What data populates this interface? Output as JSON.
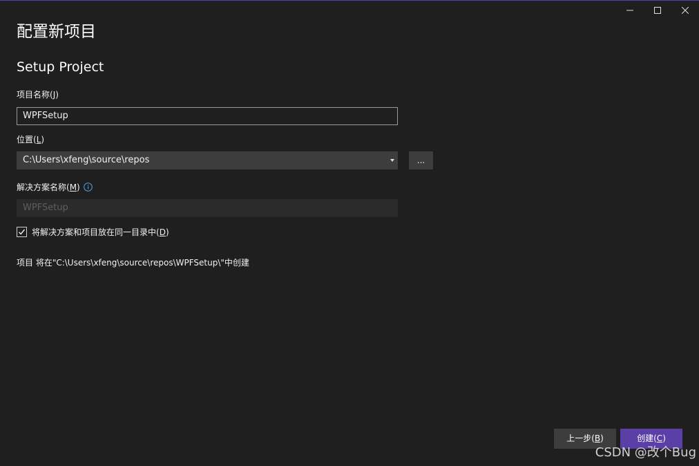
{
  "window": {
    "minimize_icon": "minimize-icon",
    "maximize_icon": "maximize-icon",
    "close_icon": "close-icon"
  },
  "header": {
    "title": "配置新项目",
    "template_name": "Setup Project"
  },
  "project_name": {
    "label": "项目名称(",
    "accel": "J",
    "label_end": ")",
    "value": "WPFSetup"
  },
  "location": {
    "label": "位置(",
    "accel": "L",
    "label_end": ")",
    "value": "C:\\Users\\xfeng\\source\\repos",
    "browse_label": "..."
  },
  "solution_name": {
    "label": "解决方案名称(",
    "accel": "M",
    "label_end": ")",
    "value": "WPFSetup",
    "info_icon": "info-icon"
  },
  "same_directory": {
    "checked": true,
    "label": "将解决方案和项目放在同一目录中(",
    "accel": "D",
    "label_end": ")"
  },
  "info_text": "项目 将在\"C:\\Users\\xfeng\\source\\repos\\WPFSetup\\\"中创建",
  "footer": {
    "back_label": "上一步(",
    "back_accel": "B",
    "back_end": ")",
    "create_label": "创建(",
    "create_accel": "C",
    "create_end": ")"
  },
  "watermark": "CSDN @改个Bug",
  "colors": {
    "background": "#1f1f1f",
    "accent": "#5a3fa6",
    "control": "#3d3d3d"
  }
}
